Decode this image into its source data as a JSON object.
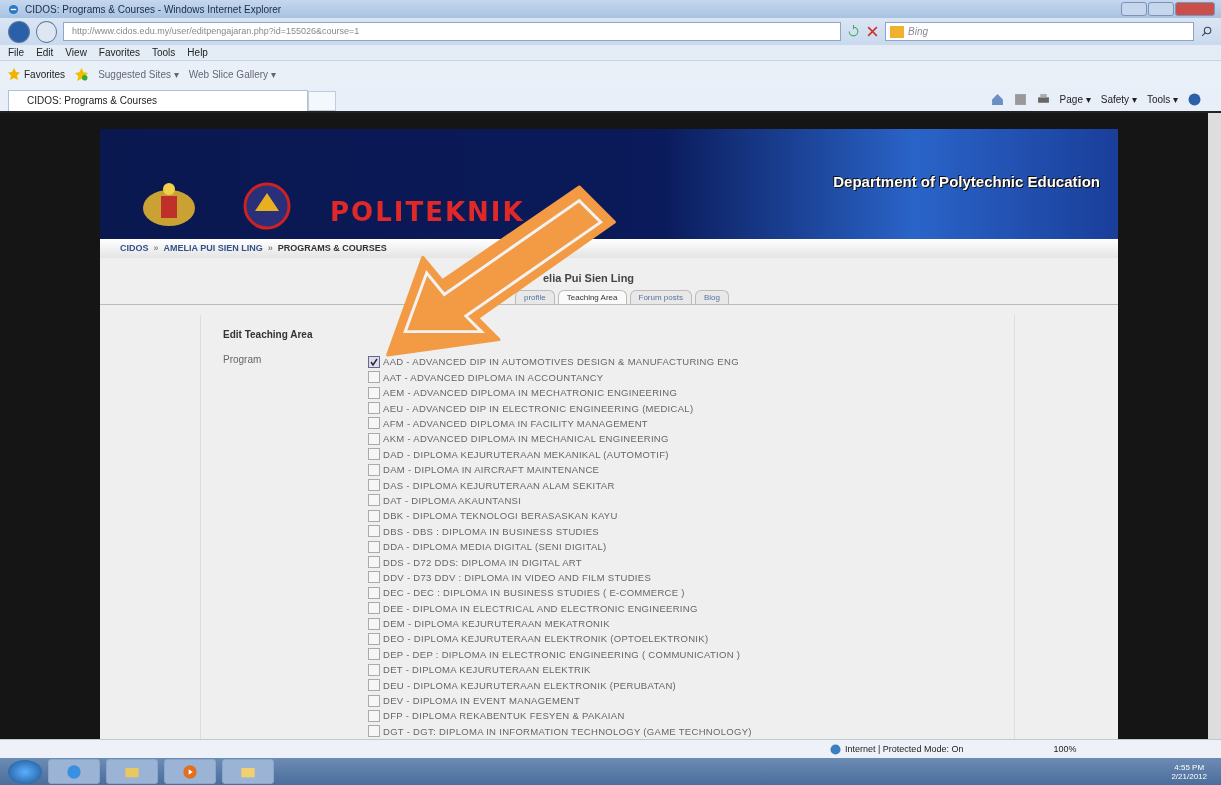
{
  "window": {
    "title": "CIDOS: Programs & Courses - Windows Internet Explorer"
  },
  "address_bar": {
    "url": "http://www.cidos.edu.my/user/editpengajaran.php?id=155026&course=1",
    "search_placeholder": "Bing"
  },
  "menu": [
    "File",
    "Edit",
    "View",
    "Favorites",
    "Tools",
    "Help"
  ],
  "favorites_bar": [
    {
      "kind": "favorites",
      "label": "Favorites"
    },
    {
      "kind": "add"
    },
    {
      "kind": "site",
      "label": "Suggested Sites ▾"
    },
    {
      "kind": "site",
      "label": "Web Slice Gallery ▾"
    }
  ],
  "browser_tabs": [
    {
      "label": "CIDOS: Programs & Courses",
      "selected": true
    }
  ],
  "command_bar": [
    "Page ▾",
    "Safety ▾",
    "Tools ▾"
  ],
  "page": {
    "banner_title": "Department of Polytechnic Education",
    "banner_logo": "POLITEKNIK",
    "breadcrumb": [
      {
        "label": "CIDOS",
        "link": true
      },
      {
        "separator": "»",
        "label": "AMELIA PUI SIEN LING",
        "link": true
      },
      {
        "separator": "»",
        "label": "PROGRAMS & COURSES",
        "link": false
      }
    ],
    "user_name": "elia Pui Sien Ling",
    "tabs": [
      {
        "label": "profile",
        "selected": false
      },
      {
        "label": "Teaching Area",
        "selected": true
      },
      {
        "label": "Forum posts",
        "selected": false
      },
      {
        "label": "Blog",
        "selected": false
      }
    ],
    "form_title": "Edit Teaching Area",
    "field_label": "Program",
    "programs": [
      {
        "label": "AAD - ADVANCED DIP IN AUTOMOTIVES DESIGN & MANUFACTURING ENG",
        "checked": true
      },
      {
        "label": "AAT - ADVANCED DIPLOMA IN ACCOUNTANCY",
        "checked": false
      },
      {
        "label": "AEM - ADVANCED DIPLOMA IN MECHATRONIC ENGINEERING",
        "checked": false
      },
      {
        "label": "AEU - ADVANCED DIP IN ELECTRONIC ENGINEERING (MEDICAL)",
        "checked": false
      },
      {
        "label": "AFM - ADVANCED DIPLOMA IN FACILITY MANAGEMENT",
        "checked": false
      },
      {
        "label": "AKM - ADVANCED DIPLOMA IN MECHANICAL ENGINEERING",
        "checked": false
      },
      {
        "label": "DAD - DIPLOMA KEJURUTERAAN MEKANIKAL (AUTOMOTIF)",
        "checked": false
      },
      {
        "label": "DAM - DIPLOMA IN AIRCRAFT MAINTENANCE",
        "checked": false
      },
      {
        "label": "DAS - DIPLOMA KEJURUTERAAN ALAM SEKITAR",
        "checked": false
      },
      {
        "label": "DAT - DIPLOMA AKAUNTANSI",
        "checked": false
      },
      {
        "label": "DBK - DIPLOMA TEKNOLOGI BERASASKAN KAYU",
        "checked": false
      },
      {
        "label": "DBS - DBS : DIPLOMA IN BUSINESS STUDIES",
        "checked": false
      },
      {
        "label": "DDA - DIPLOMA MEDIA DIGITAL (SENI DIGITAL)",
        "checked": false
      },
      {
        "label": "DDS - D72 DDS: DIPLOMA IN DIGITAL ART",
        "checked": false
      },
      {
        "label": "DDV - D73 DDV : DIPLOMA IN VIDEO AND FILM STUDIES",
        "checked": false
      },
      {
        "label": "DEC - DEC : DIPLOMA IN BUSINESS STUDIES ( E-COMMERCE )",
        "checked": false
      },
      {
        "label": "DEE - DIPLOMA IN ELECTRICAL AND ELECTRONIC ENGINEERING",
        "checked": false
      },
      {
        "label": "DEM - DIPLOMA KEJURUTERAAN MEKATRONIK",
        "checked": false
      },
      {
        "label": "DEO - DIPLOMA KEJURUTERAAN ELEKTRONIK (OPTOELEKTRONIK)",
        "checked": false
      },
      {
        "label": "DEP - DEP : DIPLOMA IN ELECTRONIC ENGINEERING ( COMMUNICATION )",
        "checked": false
      },
      {
        "label": "DET - DIPLOMA KEJURUTERAAN ELEKTRIK",
        "checked": false
      },
      {
        "label": "DEU - DIPLOMA KEJURUTERAAN ELEKTRONIK (PERUBATAN)",
        "checked": false
      },
      {
        "label": "DEV - DIPLOMA IN EVENT MANAGEMENT",
        "checked": false
      },
      {
        "label": "DFP - DIPLOMA REKABENTUK FESYEN & PAKAIAN",
        "checked": false
      },
      {
        "label": "DGT - DGT: DIPLOMA IN INFORMATION TECHNOLOGY (GAME TECHNOLOGY)",
        "checked": false
      }
    ]
  },
  "status_bar": {
    "zone": "Internet | Protected Mode: On",
    "zoom": "100%"
  },
  "taskbar": {
    "time": "4:55 PM",
    "date": "2/21/2012"
  }
}
